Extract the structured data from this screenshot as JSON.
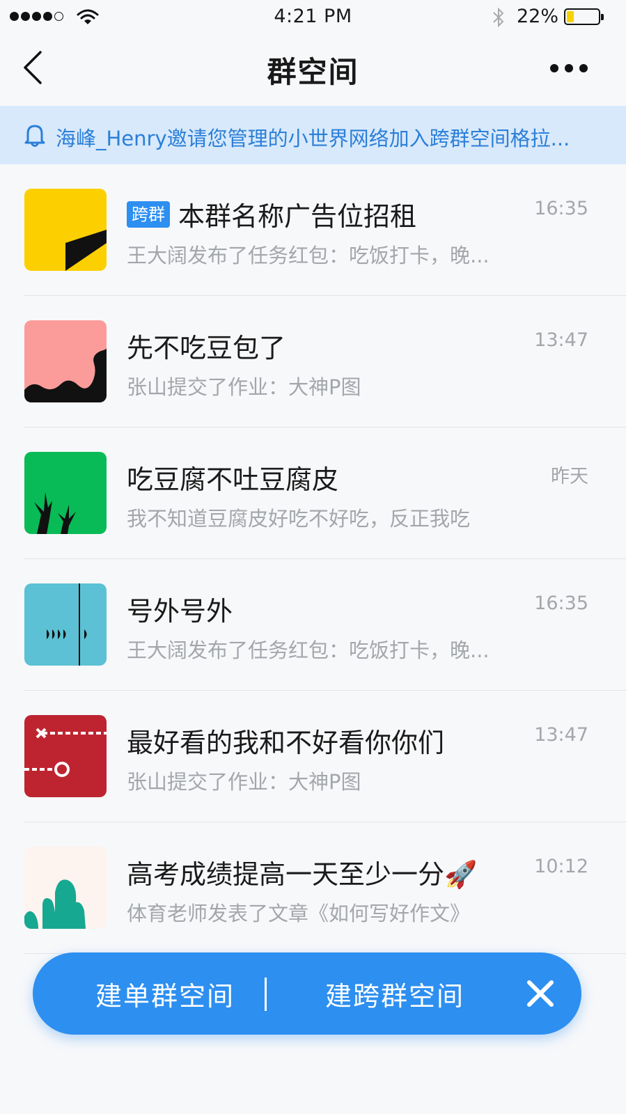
{
  "status_bar": {
    "time": "4:21 PM",
    "battery_percent": "22%",
    "battery_level": 0.22
  },
  "nav": {
    "title": "群空间"
  },
  "notice": {
    "text": "海峰_Henry邀请您管理的小世界网络加入跨群空间格拉..."
  },
  "rows": [
    {
      "tag": "跨群",
      "title": "本群名称广告位招租",
      "subtitle": "王大阔发布了任务红包：吃饭打卡，晚...",
      "time": "16:35",
      "avatar_color": "#fcd000"
    },
    {
      "title": "先不吃豆包了",
      "subtitle": "张山提交了作业：大神P图",
      "time": "13:47",
      "avatar_color": "#fb9c9a"
    },
    {
      "title": "吃豆腐不吐豆腐皮",
      "subtitle": "我不知道豆腐皮好吃不好吃，反正我吃",
      "time": "昨天",
      "avatar_color": "#08bb56"
    },
    {
      "title": "号外号外",
      "subtitle": "王大阔发布了任务红包：吃饭打卡，晚...",
      "time": "16:35",
      "avatar_color": "#5cc1d4"
    },
    {
      "title": "最好看的我和不好看你你们",
      "subtitle": "张山提交了作业：大神P图",
      "time": "13:47",
      "avatar_color": "#be2430"
    },
    {
      "title": "高考成绩提高一天至少一分🚀",
      "subtitle": "体育老师发表了文章《如何写好作文》",
      "time": "10:12",
      "avatar_color": "#fdf3ef"
    }
  ],
  "actions": {
    "single_group": "建单群空间",
    "cross_group": "建跨群空间"
  },
  "colors": {
    "accent": "#2d8ff0",
    "notice_bg": "#d8e9fb",
    "notice_text": "#2b7fd8"
  },
  "icons": [
    "back-arrow-icon",
    "more-icon",
    "bell-icon",
    "wifi-icon",
    "bluetooth-icon",
    "battery-icon",
    "close-icon"
  ]
}
